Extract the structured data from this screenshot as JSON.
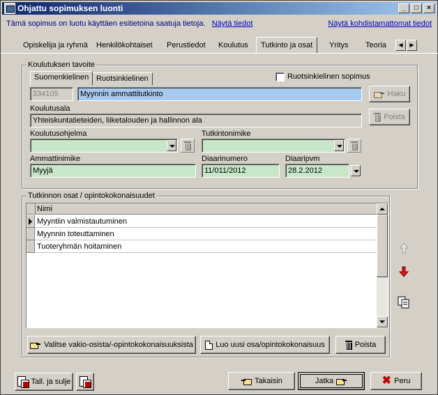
{
  "window": {
    "title": "Ohjattu sopimuksen luonti",
    "minimize": "_",
    "maximize": "□",
    "close": "×"
  },
  "infobar": {
    "text": "Tämä sopimus on luotu käyttäen esitietoina saatuja tietoja.",
    "link_show": "Näytä tiedot",
    "link_unmatched": "Näytä kohdistamattomat tiedot"
  },
  "tabs": [
    {
      "label": "Opiskelija ja ryhmä"
    },
    {
      "label": "Henkilökohtaiset"
    },
    {
      "label": "Perustiedot"
    },
    {
      "label": "Koulutus"
    },
    {
      "label": "Tutkinto ja osat"
    },
    {
      "label": "Yritys"
    },
    {
      "label": "Teoria"
    }
  ],
  "tab_scroll": {
    "left": "◀",
    "right": "▶"
  },
  "goal": {
    "legend": "Koulutuksen tavoite",
    "subtabs": [
      "Suomenkielinen",
      "Ruotsinkielinen"
    ],
    "swedish_contract_label": "Ruotsinkielinen sopimus",
    "code": "334105",
    "qualification": "Myynnin ammattitutkinto",
    "btn_search": "Haku",
    "btn_remove": "Poista",
    "field_label": "Koulutusala",
    "field_value": "Yhteiskuntatieteiden, liiketalouden ja hallinnon ala",
    "programme_label": "Koulutusohjelma",
    "programme_value": "",
    "degree_title_label": "Tutkintonimike",
    "degree_title_value": "",
    "occupation_label": "Ammattinimike",
    "occupation_value": "Myyjä",
    "journal_no_label": "Diaarinumero",
    "journal_no_value": "11/011/2012",
    "journal_date_label": "Diaaripvm",
    "journal_date_value": "28.2.2012"
  },
  "parts": {
    "legend": "Tutkinnon osat / opintokokonaisuudet",
    "column": "Nimi",
    "rows": [
      "Myyntiin valmistautuminen",
      "Myynnin toteuttaminen",
      "Tuoteryhmän hoitaminen"
    ],
    "btn_select": "Valitse vakio-osista/-opintokokonaisuuksista",
    "btn_new": "Luo uusi osa/opintokokonaisuus",
    "btn_remove": "Poista"
  },
  "footer": {
    "btn_save_close": "Tall. ja sulje",
    "btn_back": "Takaisin",
    "btn_next": "Jatka",
    "btn_cancel": "Peru"
  }
}
